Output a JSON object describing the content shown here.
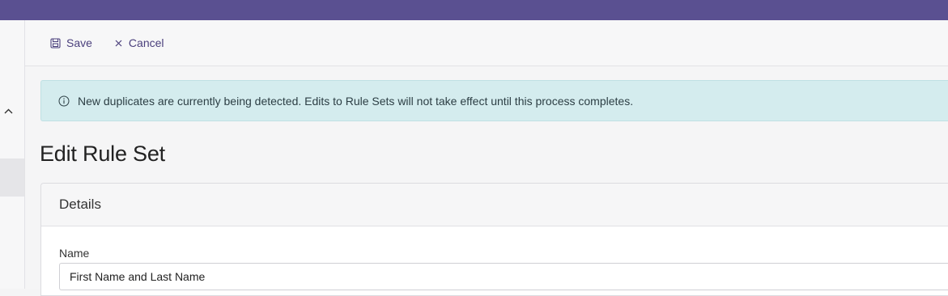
{
  "toolbar": {
    "save_label": "Save",
    "cancel_label": "Cancel",
    "save_icon": "save-icon",
    "cancel_icon": "close-icon"
  },
  "alert": {
    "icon": "info-icon",
    "message": "New duplicates are currently being detected. Edits to Rule Sets will not take effect until this process completes."
  },
  "page": {
    "title": "Edit Rule Set"
  },
  "details_card": {
    "header": "Details",
    "name_label": "Name",
    "name_value": "First Name and Last Name"
  },
  "colors": {
    "topbar": "#5a5091",
    "accent": "#4a3f7c",
    "alert_bg": "#d4ecee"
  }
}
